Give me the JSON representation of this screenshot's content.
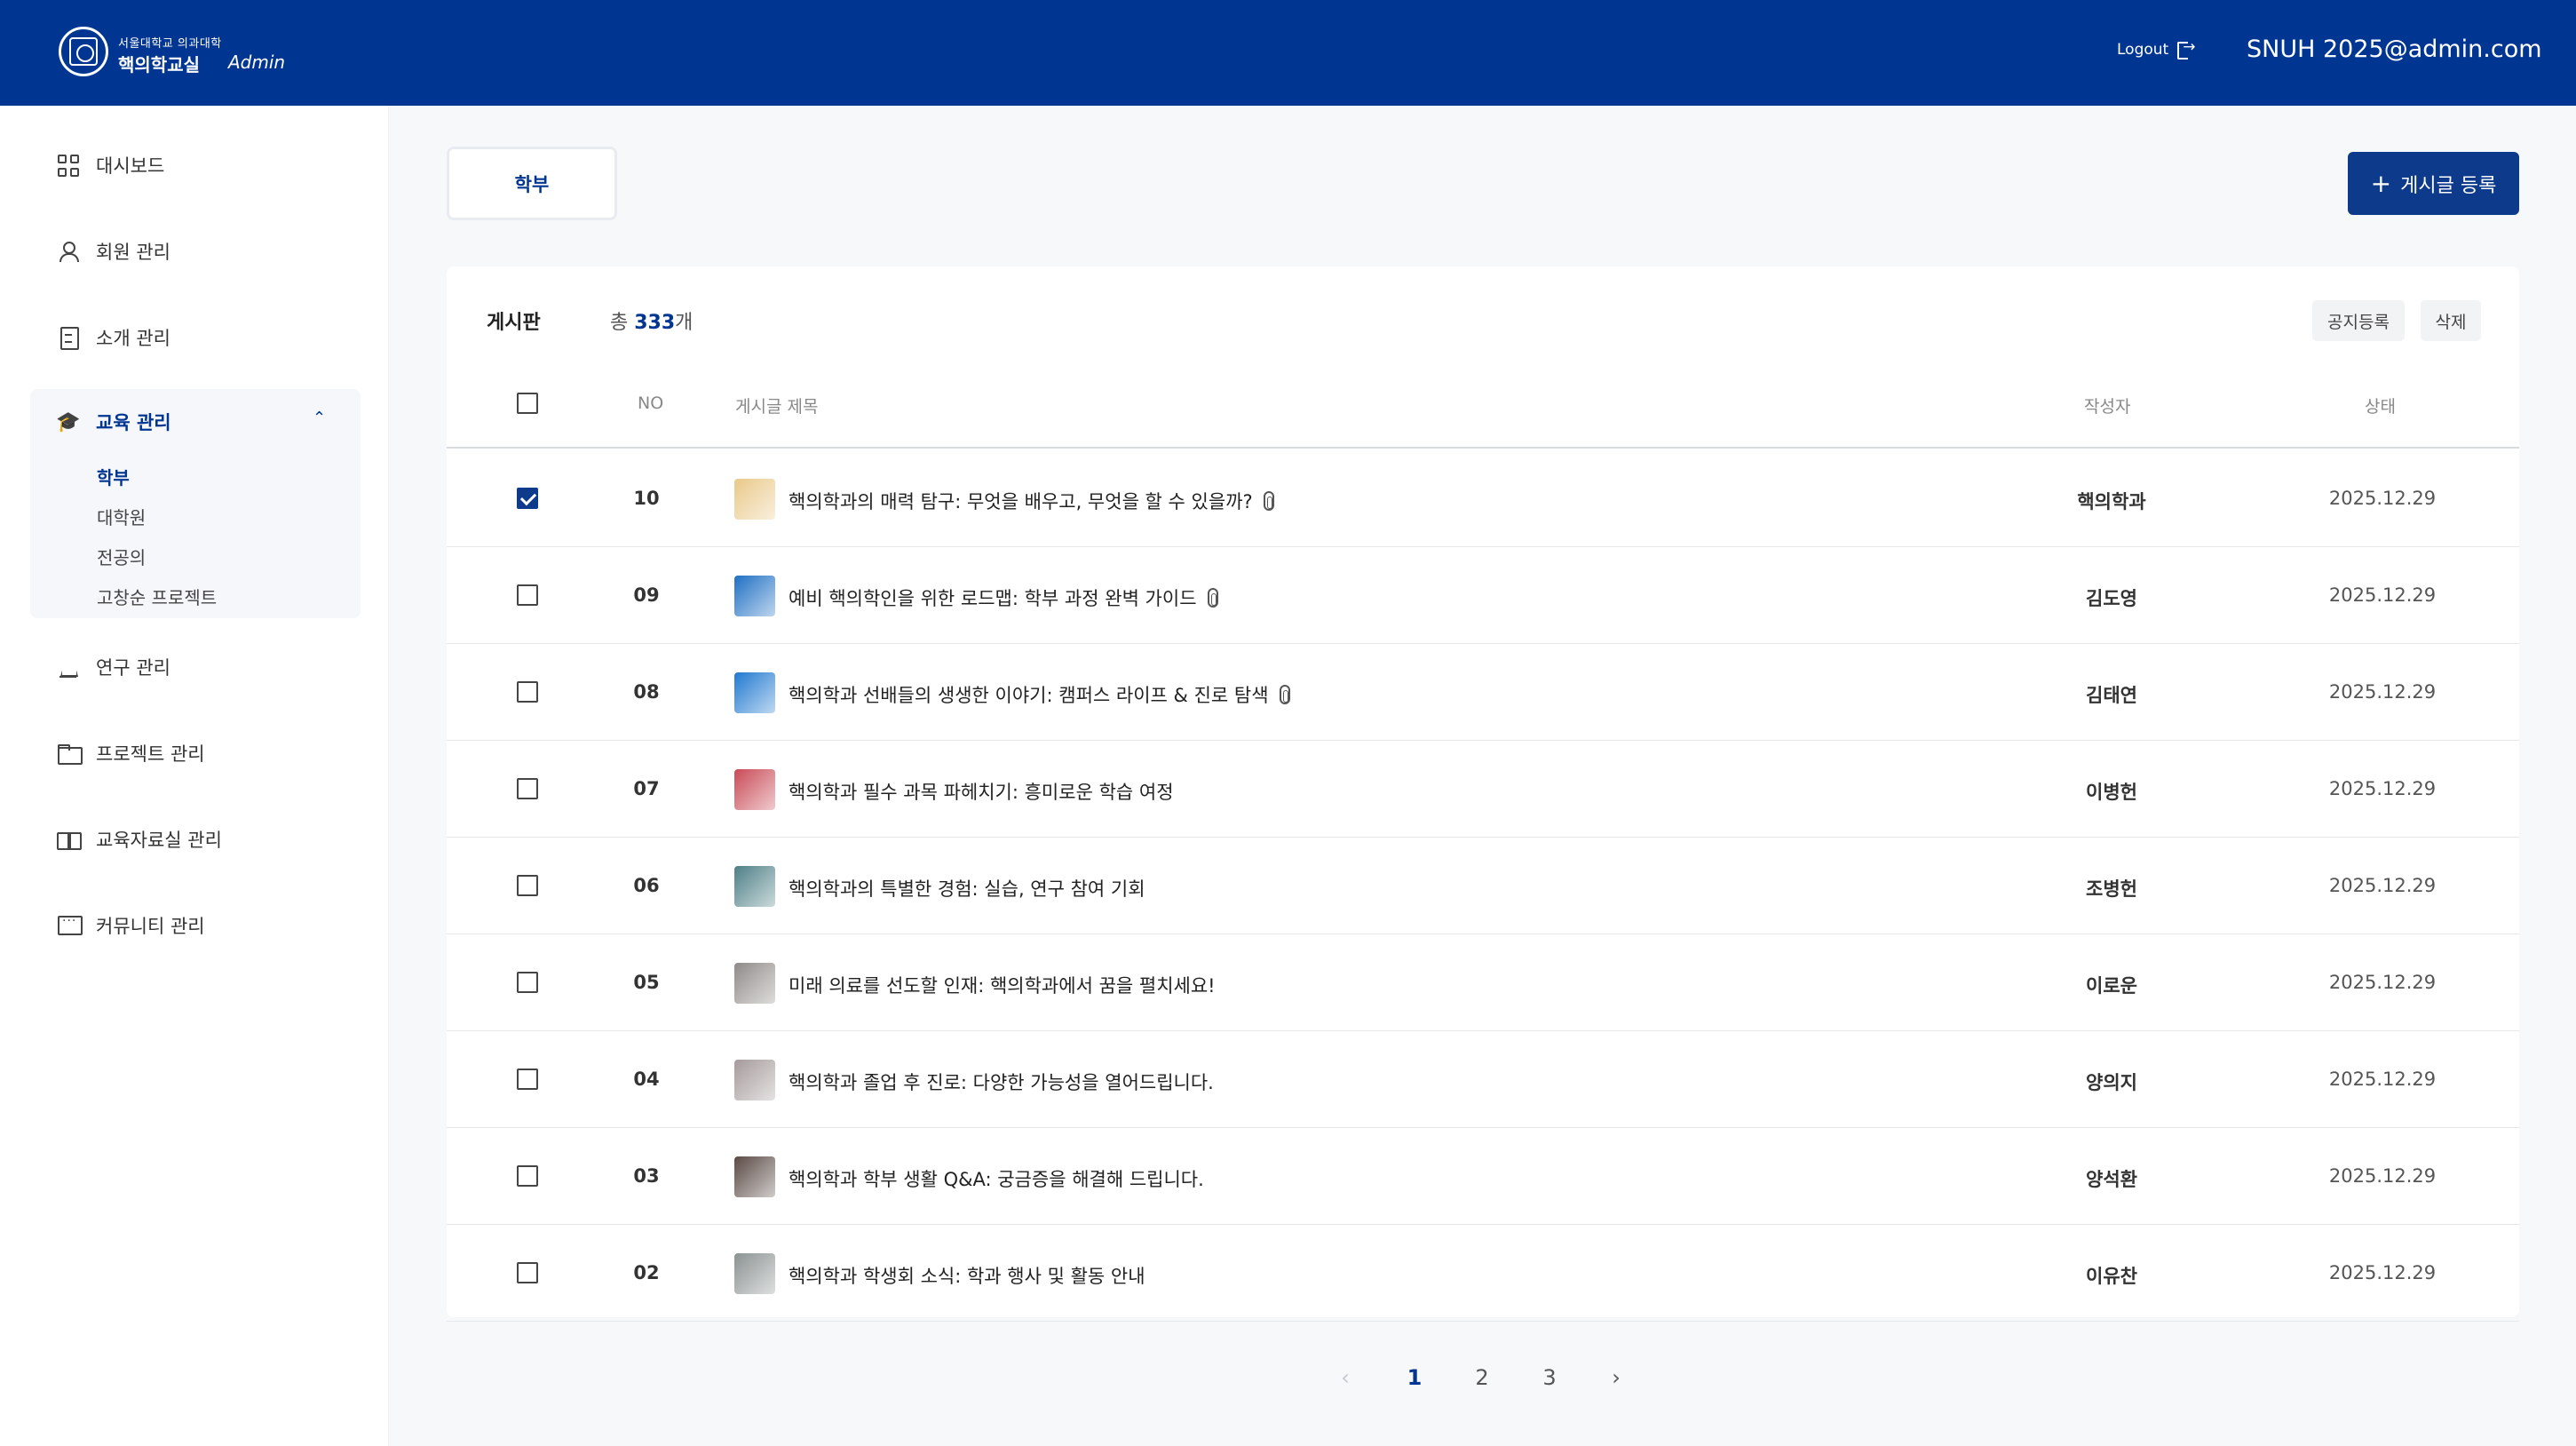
{
  "header": {
    "brand_sub": "서울대학교 의과대학",
    "brand_main": "핵의학교실",
    "brand_admin": "Admin",
    "logout_label": "Logout",
    "user_email": "SNUH 2025@admin.com",
    "color": "#003591"
  },
  "sidebar": {
    "items": [
      {
        "label": "대시보드",
        "icon": "dashboard-grid-icon"
      },
      {
        "label": "회원 관리",
        "icon": "user-icon"
      },
      {
        "label": "소개 관리",
        "icon": "document-icon"
      },
      {
        "label": "교육 관리",
        "icon": "graduation-cap-icon"
      },
      {
        "label": "연구 관리",
        "icon": "flask-icon"
      },
      {
        "label": "프로젝트 관리",
        "icon": "folder-icon"
      },
      {
        "label": "교육자료실 관리",
        "icon": "book-icon"
      },
      {
        "label": "커뮤니티 관리",
        "icon": "chat-icon"
      }
    ],
    "education_sub": [
      {
        "label": "학부",
        "active": true
      },
      {
        "label": "대학원",
        "active": false
      },
      {
        "label": "전공의",
        "active": false
      },
      {
        "label": "고창순 프로젝트",
        "active": false
      }
    ]
  },
  "main": {
    "tab_label": "학부",
    "create_label": "게시글 등록",
    "board_title": "게시판",
    "total_prefix": "총 ",
    "total_count": "333",
    "total_suffix": "개",
    "notice_button": "공지등록",
    "delete_button": "삭제",
    "columns": {
      "no": "NO",
      "title": "게시글 제목",
      "author": "작성자",
      "status": "상태"
    },
    "rows": [
      {
        "no": "10",
        "title": "핵의학과의 매력 탐구: 무엇을 배우고, 무엇을 할 수 있을까?",
        "author": "핵의학과",
        "date": "2025.12.29",
        "checked": true,
        "attachment": true,
        "thumb": "#e9c98a"
      },
      {
        "no": "09",
        "title": "예비 핵의학인을 위한 로드맵: 학부 과정 완벽 가이드",
        "author": "김도영",
        "date": "2025.12.29",
        "checked": false,
        "attachment": true,
        "thumb": "#1f6fc4"
      },
      {
        "no": "08",
        "title": "핵의학과 선배들의 생생한 이야기: 캠퍼스 라이프 & 진로 탐색",
        "author": "김태연",
        "date": "2025.12.29",
        "checked": false,
        "attachment": true,
        "thumb": "#2079d0"
      },
      {
        "no": "07",
        "title": "핵의학과 필수 과목 파헤치기: 흥미로운 학습 여정",
        "author": "이병헌",
        "date": "2025.12.29",
        "checked": false,
        "attachment": false,
        "thumb": "#c94a56"
      },
      {
        "no": "06",
        "title": "핵의학과의 특별한 경험: 실습, 연구 참여 기회",
        "author": "조병헌",
        "date": "2025.12.29",
        "checked": false,
        "attachment": false,
        "thumb": "#4e7f86"
      },
      {
        "no": "05",
        "title": "미래 의료를 선도할 인재: 핵의학과에서 꿈을 펼치세요!",
        "author": "이로운",
        "date": "2025.12.29",
        "checked": false,
        "attachment": false,
        "thumb": "#8f8a88"
      },
      {
        "no": "04",
        "title": "핵의학과 졸업 후 진로: 다양한 가능성을 열어드립니다.",
        "author": "양의지",
        "date": "2025.12.29",
        "checked": false,
        "attachment": false,
        "thumb": "#a59a9b"
      },
      {
        "no": "03",
        "title": "핵의학과 학부 생활 Q&A: 궁금증을 해결해 드립니다.",
        "author": "양석환",
        "date": "2025.12.29",
        "checked": false,
        "attachment": false,
        "thumb": "#5a4a45"
      },
      {
        "no": "02",
        "title": "핵의학과 학생회 소식: 학과 행사 및 활동 안내",
        "author": "이유찬",
        "date": "2025.12.29",
        "checked": false,
        "attachment": false,
        "thumb": "#8b9291"
      }
    ],
    "pagination": {
      "pages": [
        "1",
        "2",
        "3"
      ],
      "current": "1",
      "prev": "‹",
      "next": "›"
    }
  }
}
